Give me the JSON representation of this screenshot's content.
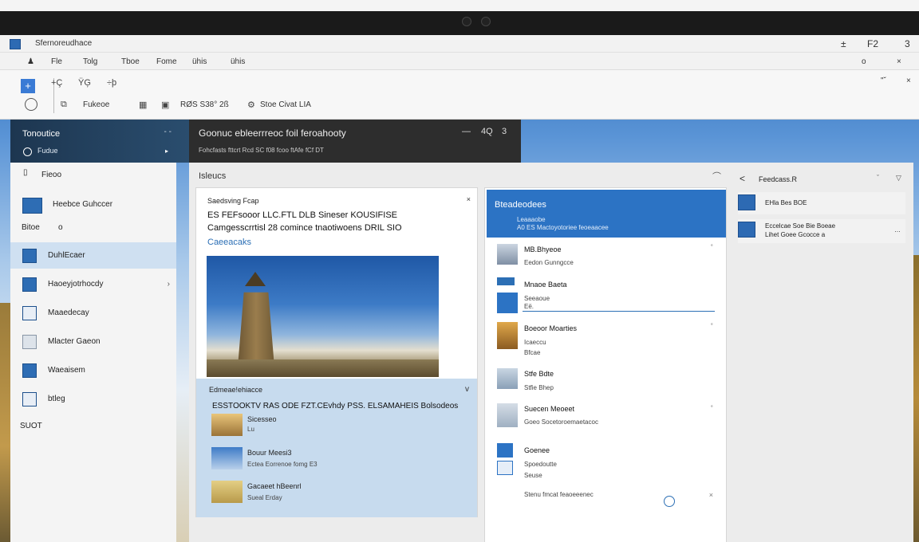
{
  "window": {
    "title": "Sfernoreudhace",
    "controls": [
      "±",
      "F2",
      "3"
    ],
    "controls2": [
      "o",
      "×"
    ]
  },
  "menu": {
    "items": [
      "Fle",
      "Tolg",
      "Tboe",
      "Fome",
      "ühis"
    ]
  },
  "ribbon": {
    "glyphs_top": [
      "+Ç",
      "ŸĢ",
      "÷þ"
    ],
    "items": [
      "Fukeoe",
      "RØS  S38°  2ß",
      "Stoe Civat LIA"
    ],
    "right_glyphs": [
      "\"ˇ",
      "×"
    ]
  },
  "nav": {
    "header_title": "Tonoutice",
    "header_sub": "Fudue",
    "header_dots": "-  -",
    "items": [
      {
        "label": "Fieoo",
        "icon": "file-icon"
      },
      {
        "label": "Heebce Guhccer",
        "icon": "image-icon"
      },
      {
        "label": "DuhlEcaer",
        "icon": "folder-icon",
        "selected": true
      },
      {
        "label": "Haoeyjotrhocdy",
        "icon": "chart-icon",
        "chevron": true
      },
      {
        "label": "Maaedecay",
        "icon": "document-icon"
      },
      {
        "label": "Mlacter Gaeon",
        "icon": "list-icon"
      },
      {
        "label": "Waeaisem",
        "icon": "table-icon"
      },
      {
        "label": "btleg",
        "icon": "page-icon"
      }
    ],
    "free_text": [
      "Bitoe",
      "o",
      "SUOT"
    ]
  },
  "toolbar": {
    "title": "Goonuc ebleerrreoc foil feroahooty",
    "line2": "Fohcfasts  fttcrt  Rcd  SC  f08  fcoo  ftAfe  fCf  DT",
    "controls": [
      "—",
      "4Q",
      "3"
    ]
  },
  "workspace": {
    "title": "Isleucs",
    "ctrl": "⌒"
  },
  "card": {
    "title": "Saedsving Fcap",
    "line1": "ES FEFsooor LLC.FTL DLB Sineser KOUSIFISE",
    "line2": "Camgesscrrtisl  28  comince  tnaotiwoens  DRIL SIO",
    "link": "Caeeacaks",
    "close": "×",
    "lower_title": "Edmeae!ehiacce",
    "lower_chev": "v",
    "lower_line": "ESSTOOKTV RAS ODE FZT.CEvhdy PSS. ELSAMAHEIS Bolsodeos",
    "thumbs": [
      {
        "t1": "Sicesseo",
        "t2": "Lu"
      },
      {
        "t1": "Bouur Meesi3",
        "t2": "Ectea Eorrenoe fomg  E3"
      },
      {
        "t1": "Gacaeet hBeenrl",
        "t2": "Sueal Erday"
      }
    ]
  },
  "rcard": {
    "head_title": "Bteadeodees",
    "head_sub": "Leaaaobe",
    "head_sub2": "A0  ES Mactoyotoriee  feoeaacee",
    "items": [
      {
        "t1": "MB.Bhyeoe",
        "t2": "Eedon  Gunngcce",
        "dot": "˚"
      },
      {
        "t1": "Mnaoe Baeta",
        "t2": "Seeaoue",
        "t3": "Eë."
      },
      {
        "t1": "Boeoor Moarties",
        "t2": "Icaeccu",
        "t3": "Bfcae",
        "dot": "˚"
      },
      {
        "t1": "Stfe Bdte",
        "t2": "Stfie  Bhep"
      },
      {
        "t1": "Suecen Meoeet",
        "t2": "Goeo  Socetoroemaetacoc",
        "dot": "˚"
      },
      {
        "t1": "Goenee",
        "t2": "Spoedoutte",
        "t3": "Seuse"
      },
      {
        "t1": "Stenu  fmcat  feaoeeenec",
        "dot": "×"
      }
    ]
  },
  "rpanel": {
    "back": "<",
    "title": "Feedcass.R",
    "ctrl1": "ˇ",
    "ctrl2": "▽",
    "rows": [
      {
        "t1": "EHla  Bes  BOE"
      },
      {
        "t1": "Eccelcae  Soe  Bie  Boeae",
        "t2": "Lihet Goee  Gcocce a",
        "dot": "…"
      }
    ]
  },
  "colors": {
    "accent": "#2c73c4",
    "nav_header": "#1d3650",
    "dark_bar": "#2d2d2d",
    "selected": "#cfe0f1",
    "lower_panel": "#c7dbee"
  }
}
